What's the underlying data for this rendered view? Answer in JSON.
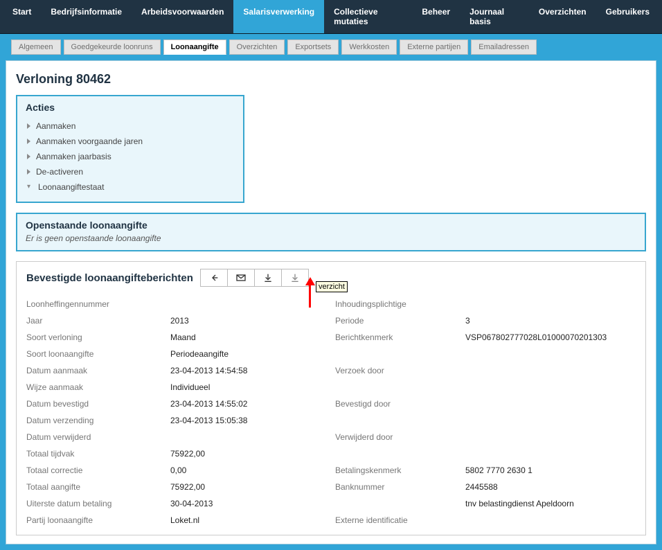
{
  "main_nav": {
    "items": [
      "Start",
      "Bedrijfsinformatie",
      "Arbeidsvoorwaarden",
      "Salarisverwerking",
      "Collectieve mutaties",
      "Beheer",
      "Journaal basis",
      "Overzichten",
      "Gebruikers"
    ],
    "active_index": 3
  },
  "sub_nav": {
    "items": [
      "Algemeen",
      "Goedgekeurde loonruns",
      "Loonaangifte",
      "Overzichten",
      "Exportsets",
      "Werkkosten",
      "Externe partijen",
      "Emailadressen"
    ],
    "active_index": 2
  },
  "page_title": "Verloning  80462",
  "acties": {
    "title": "Acties",
    "items": [
      "Aanmaken",
      "Aanmaken voorgaande jaren",
      "Aanmaken jaarbasis",
      "De-activeren",
      "Loonaangiftestaat"
    ]
  },
  "openstaande": {
    "title": "Openstaande loonaangifte",
    "message": "Er is geen openstaande loonaangifte"
  },
  "bevestigde": {
    "title": "Bevestigde loonaangifteberichten",
    "tooltip": "verzicht",
    "fields": {
      "loonheffingennummer_label": "Loonheffingennummer",
      "loonheffingennummer_value": "",
      "inhoudingsplichtige_label": "Inhoudingsplichtige",
      "inhoudingsplichtige_value": "",
      "jaar_label": "Jaar",
      "jaar_value": "2013",
      "periode_label": "Periode",
      "periode_value": "3",
      "soort_verloning_label": "Soort verloning",
      "soort_verloning_value": "Maand",
      "berichtkenmerk_label": "Berichtkenmerk",
      "berichtkenmerk_value": "VSP067802777028L01000070201303",
      "soort_loonaangifte_label": "Soort loonaangifte",
      "soort_loonaangifte_value": "Periodeaangifte",
      "datum_aanmaak_label": "Datum aanmaak",
      "datum_aanmaak_value": "23-04-2013 14:54:58",
      "verzoek_door_label": "Verzoek door",
      "verzoek_door_value": "",
      "wijze_aanmaak_label": "Wijze aanmaak",
      "wijze_aanmaak_value": "Individueel",
      "datum_bevestigd_label": "Datum bevestigd",
      "datum_bevestigd_value": "23-04-2013 14:55:02",
      "bevestigd_door_label": "Bevestigd door",
      "bevestigd_door_value": "",
      "datum_verzending_label": "Datum verzending",
      "datum_verzending_value": "23-04-2013 15:05:38",
      "datum_verwijderd_label": "Datum verwijderd",
      "datum_verwijderd_value": "",
      "verwijderd_door_label": "Verwijderd door",
      "verwijderd_door_value": "",
      "totaal_tijdvak_label": "Totaal tijdvak",
      "totaal_tijdvak_value": "75922,00",
      "totaal_correctie_label": "Totaal correctie",
      "totaal_correctie_value": "0,00",
      "betalingskenmerk_label": "Betalingskenmerk",
      "betalingskenmerk_value": "5802 7770 2630 1",
      "totaal_aangifte_label": "Totaal aangifte",
      "totaal_aangifte_value": "75922,00",
      "banknummer_label": "Banknummer",
      "banknummer_value": "2445588",
      "uiterste_datum_label": "Uiterste datum betaling",
      "uiterste_datum_value": "30-04-2013",
      "tnv_value": "tnv belastingdienst Apeldoorn",
      "partij_label": "Partij loonaangifte",
      "partij_value": "Loket.nl",
      "externe_id_label": "Externe identificatie",
      "externe_id_value": ""
    }
  },
  "icons": {
    "back": "back-arrow-icon",
    "mail": "mail-icon",
    "download1": "download-icon",
    "download2": "download-alt-icon"
  }
}
